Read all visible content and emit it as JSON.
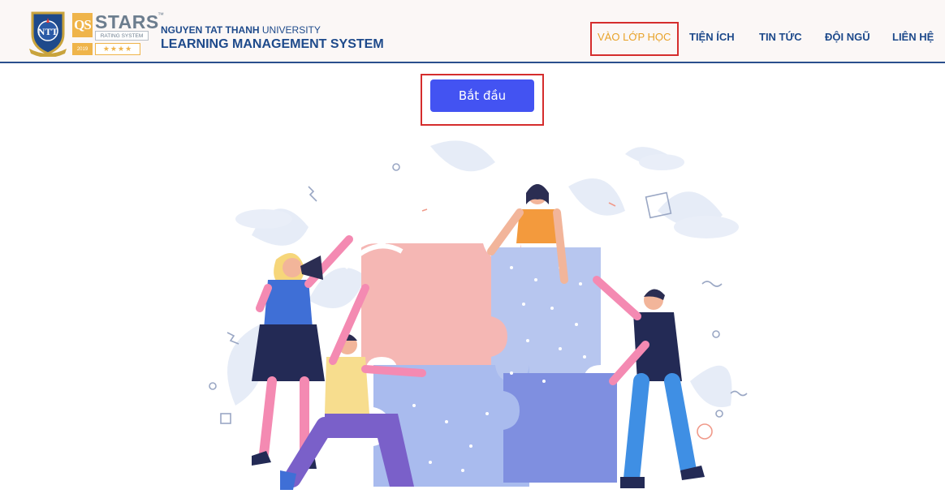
{
  "header": {
    "qs_badge": "QS",
    "qs_word": "STARS",
    "qs_tm": "™",
    "qs_rating": "RATING SYSTEM",
    "qs_year": "2019",
    "qs_star_glyphs": "★★★★",
    "university_bold": "NGUYEN TAT THANH",
    "university_rest": " UNIVERSITY",
    "lms_title": "LEARNING MANAGEMENT SYSTEM"
  },
  "nav": {
    "items": [
      {
        "label": "VÀO LỚP HỌC",
        "active": true
      },
      {
        "label": "TIỆN ÍCH",
        "active": false
      },
      {
        "label": "TIN TỨC",
        "active": false
      },
      {
        "label": "ĐỘI NGŨ",
        "active": false
      },
      {
        "label": "LIÊN HỆ",
        "active": false
      }
    ]
  },
  "main": {
    "start_button_label": "Bắt đầu"
  },
  "colors": {
    "primary_blue": "#1e4a8b",
    "nav_active": "#e8a228",
    "button_bg": "#4353f2",
    "highlight_red": "#d52d2d",
    "qs_gold": "#efb44a"
  }
}
